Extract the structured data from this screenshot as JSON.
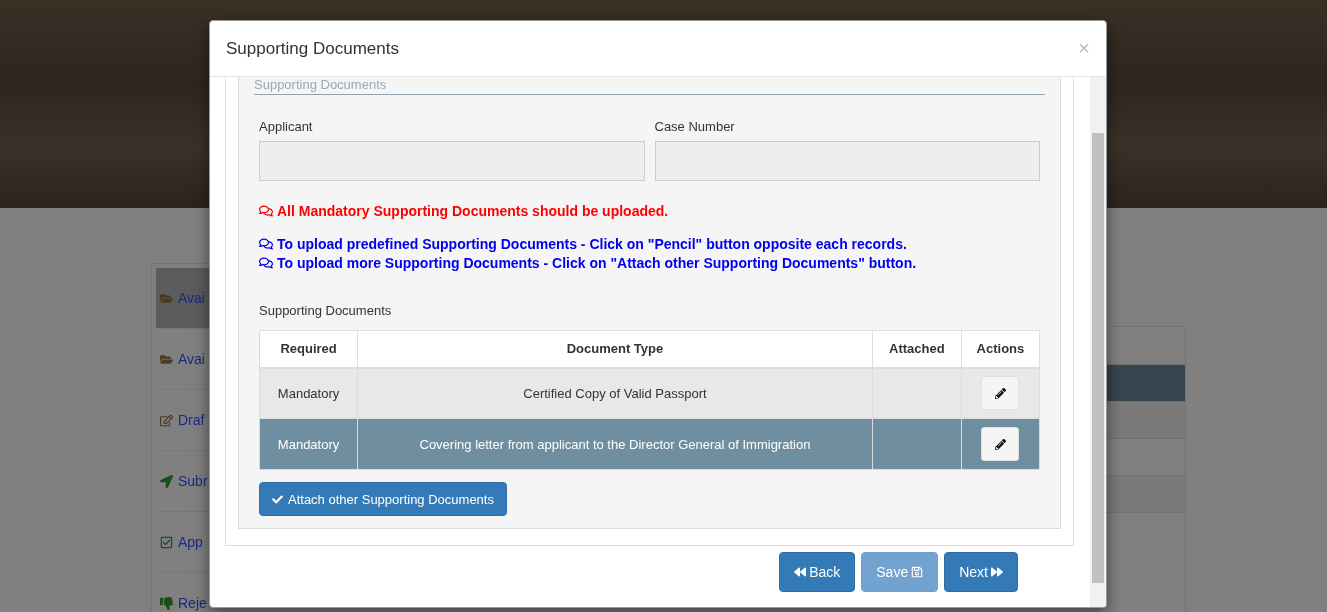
{
  "page": {
    "sidebar": {
      "items": [
        {
          "kind": "folder",
          "label": "Avai",
          "selected": true
        },
        {
          "kind": "folder",
          "label": "Avai",
          "selected": false
        },
        {
          "kind": "draft",
          "label": "Draf",
          "selected": false
        },
        {
          "kind": "send",
          "label": "Subr",
          "selected": false
        },
        {
          "kind": "approved",
          "label": "App",
          "selected": false
        },
        {
          "kind": "rejected",
          "label": "Reje",
          "selected": false
        }
      ]
    },
    "table": {
      "rows": [
        {
          "selected": true
        },
        {
          "selected": false
        },
        {
          "selected": false
        },
        {
          "selected": false
        },
        {
          "selected": false
        }
      ]
    }
  },
  "modal": {
    "title": "Supporting Documents",
    "close": "×",
    "legend": "Supporting Documents",
    "fields": [
      {
        "label": "Applicant"
      },
      {
        "label": "Case Number"
      }
    ],
    "messages": [
      {
        "kind": "warning",
        "text": "All Mandatory Supporting Documents should be uploaded."
      },
      {
        "kind": "info",
        "text": "To upload predefined Supporting Documents - Click on \"Pencil\" button opposite each records."
      },
      {
        "kind": "info",
        "text": "To upload more Supporting Documents - Click on \"Attach other Supporting Documents\" button."
      }
    ],
    "table_title": "Supporting Documents",
    "table": {
      "columns": [
        "Required",
        "Document Type",
        "Attached",
        "Actions"
      ],
      "rows": [
        {
          "required": "Mandatory",
          "document_type": "Certified Copy of Valid Passport",
          "selected": false
        },
        {
          "required": "Mandatory",
          "document_type": "Covering letter from applicant to the Director General of Immigration",
          "selected": true
        }
      ]
    },
    "attach_button": "Attach other Supporting Documents",
    "buttons": [
      {
        "kind": "back",
        "label": "Back",
        "disabled": false
      },
      {
        "kind": "save",
        "label": "Save",
        "disabled": true
      },
      {
        "kind": "next",
        "label": "Next",
        "disabled": false
      }
    ]
  }
}
